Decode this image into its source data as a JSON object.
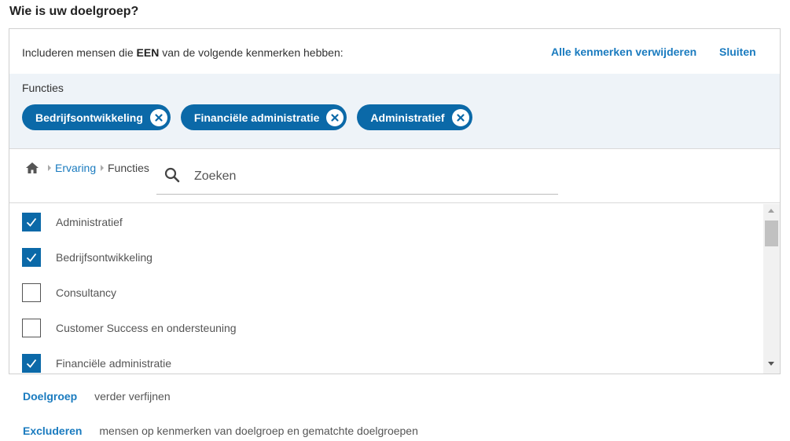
{
  "page_title": "Wie is uw doelgroep?",
  "header": {
    "include_prefix": "Includeren mensen die ",
    "include_bold": "EEN",
    "include_suffix": " van de volgende kenmerken hebben:",
    "remove_all_label": "Alle kenmerken verwijderen",
    "close_label": "Sluiten"
  },
  "selected": {
    "group_label": "Functies",
    "chips": [
      {
        "label": "Bedrijfsontwikkeling"
      },
      {
        "label": "Financiële administratie"
      },
      {
        "label": "Administratief"
      }
    ]
  },
  "breadcrumb": {
    "home_icon": "home-icon",
    "link": "Ervaring",
    "current": "Functies"
  },
  "search": {
    "placeholder": "Zoeken",
    "value": ""
  },
  "list": {
    "items": [
      {
        "label": "Administratief",
        "checked": true
      },
      {
        "label": "Bedrijfsontwikkeling",
        "checked": true
      },
      {
        "label": "Consultancy",
        "checked": false
      },
      {
        "label": "Customer Success en ondersteuning",
        "checked": false
      },
      {
        "label": "Financiële administratie",
        "checked": true
      }
    ]
  },
  "options": [
    {
      "link": "Doelgroep",
      "description": "verder verfijnen"
    },
    {
      "link": "Excluderen",
      "description": "mensen op kenmerken van doelgroep en gematchte doelgroepen"
    }
  ],
  "colors": {
    "accent": "#0b69a8",
    "link": "#1a7bbf",
    "selected_bg": "#eef3f8"
  }
}
